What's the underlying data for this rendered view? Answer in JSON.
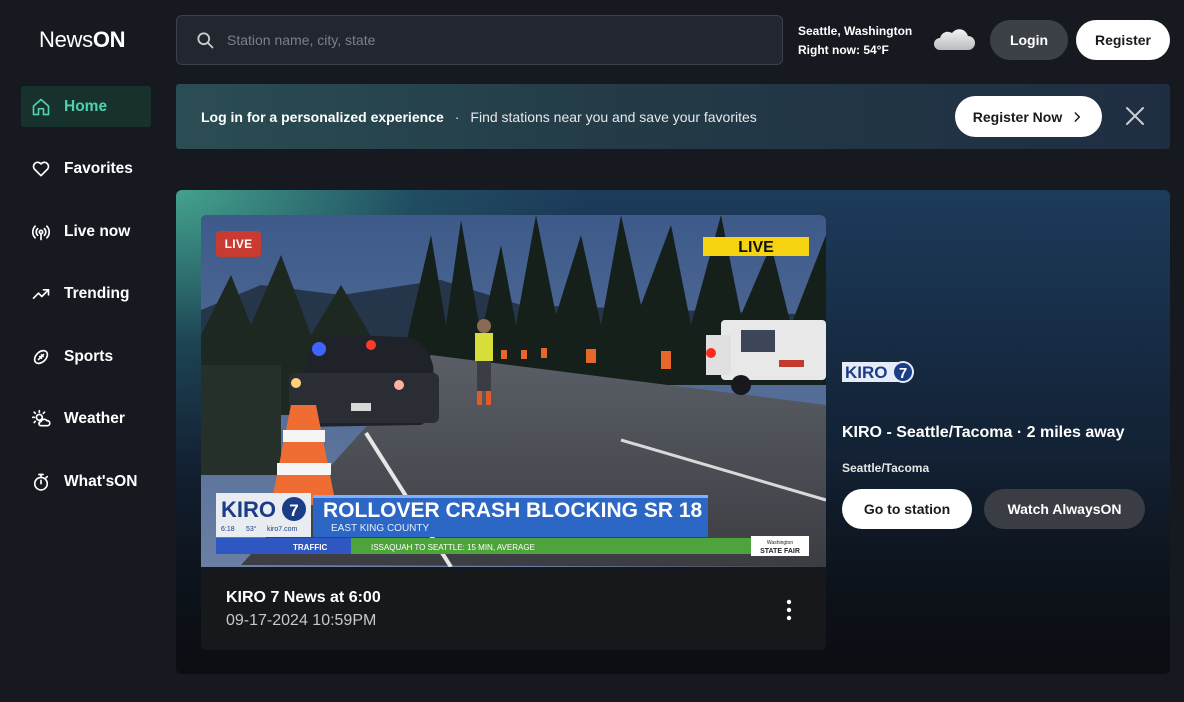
{
  "app": {
    "logo_part1": "News",
    "logo_part2": "ON"
  },
  "sidebar": {
    "items": [
      {
        "label": "Home",
        "icon": "home-icon",
        "active": true
      },
      {
        "label": "Favorites",
        "icon": "heart-icon",
        "active": false
      },
      {
        "label": "Live now",
        "icon": "broadcast-icon",
        "active": false
      },
      {
        "label": "Trending",
        "icon": "trending-icon",
        "active": false
      },
      {
        "label": "Sports",
        "icon": "football-icon",
        "active": false
      },
      {
        "label": "Weather",
        "icon": "weather-sun-cloud-icon",
        "active": false
      },
      {
        "label": "What'sON",
        "icon": "stopwatch-icon",
        "active": false
      }
    ],
    "accent_color": "#4fd1b1"
  },
  "header": {
    "search_placeholder": "Station name, city, state",
    "location": "Seattle, Washington",
    "temperature": "Right now: 54°F",
    "weather_icon": "cloud-icon",
    "login_label": "Login",
    "register_label": "Register"
  },
  "banner": {
    "bold_text": "Log in for a personalized experience",
    "separator": "·",
    "text": "Find stations near you and save your favorites",
    "cta_label": "Register Now",
    "close_icon": "close-icon"
  },
  "hero": {
    "live_badge": "LIVE",
    "video": {
      "corner_tag": "LIVE",
      "chyron_logo": "KIRO",
      "chyron_logo_num": "7",
      "chyron_headline": "ROLLOVER CRASH BLOCKING SR 18",
      "chyron_sub": "EAST KING COUNTY",
      "chyron_time": "6:18",
      "chyron_temp": "53°",
      "chyron_site": "kiro7.com",
      "ticker_label": "TRAFFIC",
      "ticker_text": "ISSAQUAH TO SEATTLE: 15 MIN, AVERAGE",
      "sponsor_top": "Washington",
      "sponsor": "STATE FAIR"
    },
    "program_title": "KIRO 7 News at 6:00",
    "program_time": "09-17-2024 10:59PM",
    "station": {
      "logo_text": "KIRO",
      "logo_num": "7",
      "name": "KIRO - Seattle/Tacoma · 2 miles away",
      "city": "Seattle/Tacoma",
      "go_label": "Go to station",
      "always_label": "Watch AlwaysON"
    }
  }
}
